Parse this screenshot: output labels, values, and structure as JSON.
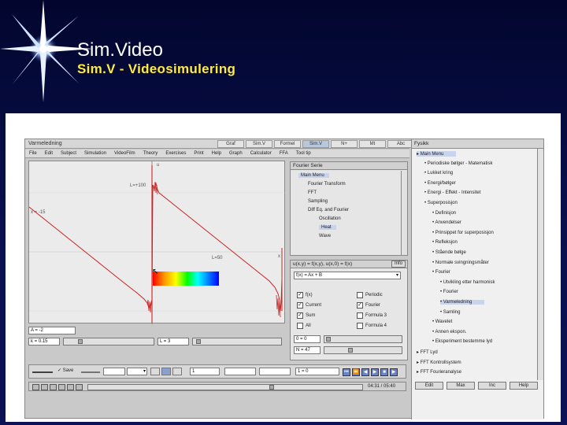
{
  "slide": {
    "title": "Sim.Video",
    "subtitle": "Sim.V  -  Videosimulering"
  },
  "app": {
    "window_title": "Varmeledning",
    "tabs": [
      "Graf",
      "Sim.V",
      "Formel",
      "Sim.V",
      "N+",
      "Mt",
      "Abc"
    ],
    "active_tab": 3,
    "menu": [
      "File",
      "Edit",
      "Subject",
      "Simulation",
      "VideoFilm",
      "Theory",
      "Exercises",
      "Print",
      "Help",
      "Graph",
      "Calculator",
      "FFA",
      "Tool tip"
    ],
    "graph": {
      "label_u": "u",
      "label_top": "L=+100",
      "label_left": "x = -15",
      "label_mid": "L=50",
      "label_x": "x"
    },
    "controls": {
      "a_value": "A = -2",
      "k_value": "k = 0.15",
      "l_value": "L = 3",
      "speed_value": "1",
      "n_value": "N = 47",
      "zero_value": "0 = 0",
      "frame_value": "1 = 0"
    },
    "fourier_panel": {
      "title": "Fourier Serie",
      "items": [
        {
          "label": "Main Menu",
          "highlight": true
        },
        {
          "label": "Fourier Transform",
          "highlight": false
        },
        {
          "label": "FFT",
          "highlight": false
        },
        {
          "label": "Sampling",
          "highlight": false
        },
        {
          "label": "Diff Eq. and Fourier",
          "highlight": false
        },
        {
          "label": "Oscillation",
          "highlight": false
        },
        {
          "label": "Heat",
          "highlight": true
        },
        {
          "label": "Wave",
          "highlight": false
        }
      ]
    },
    "formula_panel": {
      "header": "u(x,y) = f(x,y), u(x,0) = f(x)",
      "info_label": "Info",
      "dropdown_value": "f(x) = Ax + B",
      "checks": [
        {
          "label": "f(x)",
          "checked": true
        },
        {
          "label": "Periodic",
          "checked": false
        },
        {
          "label": "Current",
          "checked": true
        },
        {
          "label": "Fourier",
          "checked": true
        },
        {
          "label": "Sum",
          "checked": true
        },
        {
          "label": "Formula 3",
          "checked": false
        },
        {
          "label": "All",
          "checked": false
        },
        {
          "label": "Formula 4",
          "checked": false
        }
      ]
    },
    "bottom": {
      "save_label": "Save",
      "time_readout": "04:31 / 05:40"
    },
    "right_panel": {
      "title": "Fysikk",
      "items": [
        {
          "label": "Main Menu",
          "highlight": true,
          "indent": 0
        },
        {
          "label": "Periodiske bølger - Matematisk",
          "highlight": false,
          "indent": 1
        },
        {
          "label": "Lukket kring",
          "highlight": false,
          "indent": 1
        },
        {
          "label": "Energi/bølger",
          "highlight": false,
          "indent": 1
        },
        {
          "label": "Energi - Effekt - Intensitet",
          "highlight": false,
          "indent": 1
        },
        {
          "label": "Superposisjon",
          "highlight": false,
          "indent": 1
        },
        {
          "label": "Definisjon",
          "highlight": false,
          "indent": 2
        },
        {
          "label": "Anvendelser",
          "highlight": false,
          "indent": 2
        },
        {
          "label": "Prinsippet for superposisjon",
          "highlight": false,
          "indent": 2
        },
        {
          "label": "Refleksjon",
          "highlight": false,
          "indent": 2
        },
        {
          "label": "Stående bølge",
          "highlight": false,
          "indent": 2
        },
        {
          "label": "Normale svingningsmåter",
          "highlight": false,
          "indent": 2
        },
        {
          "label": "Fourier",
          "highlight": false,
          "indent": 2
        },
        {
          "label": "Utvikling etter harmonisk",
          "highlight": false,
          "indent": 3
        },
        {
          "label": "Fourier",
          "highlight": false,
          "indent": 3
        },
        {
          "label": "Varmeledning",
          "highlight": true,
          "indent": 3
        },
        {
          "label": "Samling",
          "highlight": false,
          "indent": 3
        },
        {
          "label": "Wavelet",
          "highlight": false,
          "indent": 2
        },
        {
          "label": "Annen ekspon.",
          "highlight": false,
          "indent": 2
        },
        {
          "label": "Eksperiment bestemme lyd",
          "highlight": false,
          "indent": 2
        },
        {
          "label": "FFT Lyd",
          "highlight": false,
          "indent": 0
        },
        {
          "label": "FFT Kontrollsystem",
          "highlight": false,
          "indent": 0
        },
        {
          "label": "FFT Fourieranalyse",
          "highlight": false,
          "indent": 0
        }
      ],
      "buttons": [
        "Edit",
        "Max",
        "Inc",
        "Help"
      ]
    }
  }
}
